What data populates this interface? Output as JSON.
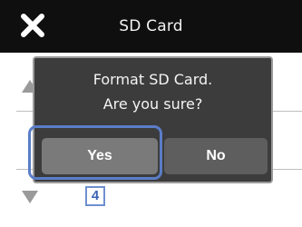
{
  "header": {
    "title": "SD Card",
    "close_icon": "close-x-icon"
  },
  "dialog": {
    "line1": "Format SD Card.",
    "line2": "Are you sure?",
    "yes_label": "Yes",
    "no_label": "No"
  },
  "annotation": {
    "step_number": "4",
    "highlight_color": "#5a7dc8"
  },
  "colors": {
    "header_bg": "#0f0f0f",
    "dialog_bg": "#3c3c3c",
    "yes_button": "#7a7a7a",
    "no_button": "#5e5e5e"
  }
}
